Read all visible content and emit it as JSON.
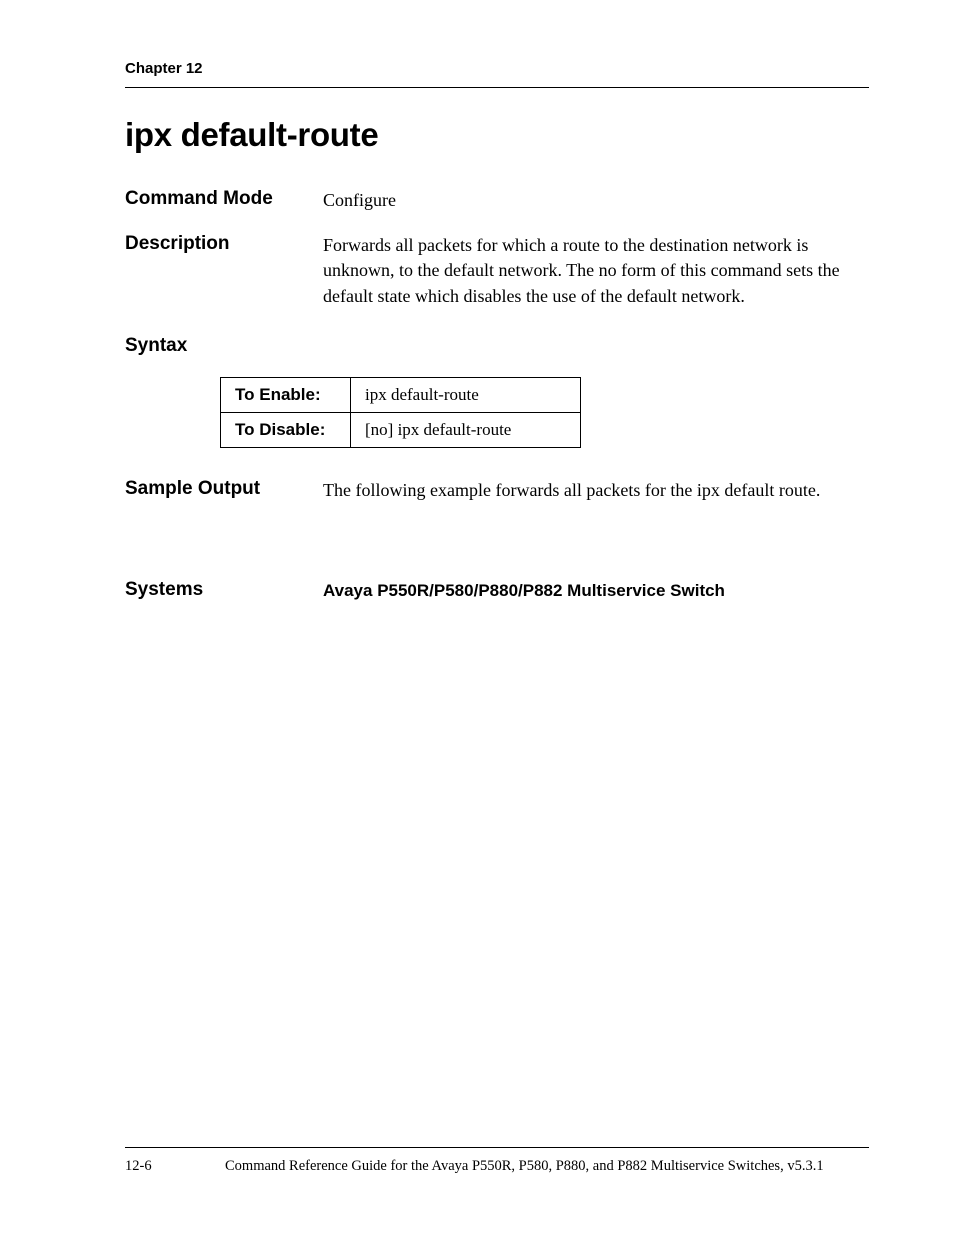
{
  "header": {
    "chapter": "Chapter 12"
  },
  "title": "ipx default-route",
  "sections": {
    "commandMode": {
      "label": "Command Mode",
      "value": "Configure"
    },
    "description": {
      "label": "Description",
      "value": "Forwards all packets for which a route to the destination network is unknown, to the default network. The no form of this command sets the default state which disables the use of the default network."
    },
    "syntax": {
      "label": "Syntax",
      "rows": [
        {
          "label": "To Enable:",
          "value": "ipx default-route"
        },
        {
          "label": "To Disable:",
          "value": "[no] ipx default-route"
        }
      ]
    },
    "sampleOutput": {
      "label": "Sample Output",
      "value": "The following example forwards all packets for the ipx default route."
    },
    "systems": {
      "label": "Systems",
      "value": "Avaya P550R/P580/P880/P882 Multiservice Switch"
    }
  },
  "footer": {
    "pageNumber": "12-6",
    "title": "Command Reference Guide for the Avaya P550R, P580, P880, and P882 Multiservice Switches, v5.3.1"
  }
}
